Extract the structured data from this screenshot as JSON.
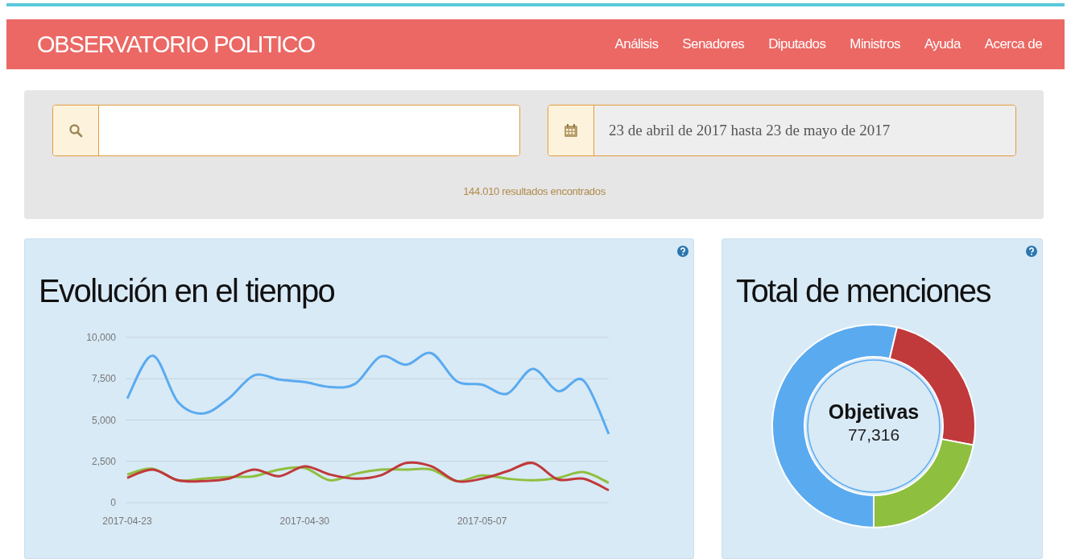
{
  "navbar": {
    "brand": "OBSERVATORIO POLITICO",
    "links": [
      "Análisis",
      "Senadores",
      "Diputados",
      "Ministros",
      "Ayuda",
      "Acerca de"
    ]
  },
  "search": {
    "date_field": {
      "value": "23 de abril de 2017 hasta 23 de mayo de 2017"
    },
    "results": "144.010 resultados encontrados"
  },
  "evolution_card": {
    "title": "Evolución en el tiempo",
    "chart_data": {
      "type": "line",
      "grid": true,
      "categories": [
        "2017-04-23",
        null,
        null,
        null,
        null,
        null,
        null,
        "2017-04-30",
        null,
        null,
        null,
        null,
        null,
        null,
        "2017-05-07",
        null,
        null,
        null,
        null,
        null
      ],
      "series": [
        {
          "color": "#5aaaf0",
          "values": [
            6300,
            8900,
            6100,
            5400,
            6300,
            7700,
            7450,
            7300,
            7000,
            7200,
            8850,
            8350,
            9050,
            7350,
            7150,
            6600,
            8100,
            6750,
            7400,
            4150
          ]
        },
        {
          "color": "#8fbf3f",
          "values": [
            1700,
            2050,
            1350,
            1450,
            1550,
            1600,
            2000,
            2100,
            1350,
            1750,
            2000,
            2000,
            2000,
            1300,
            1650,
            1450,
            1350,
            1500,
            1850,
            1200
          ]
        },
        {
          "color": "#c0393b",
          "values": [
            1500,
            2000,
            1350,
            1300,
            1450,
            2000,
            1600,
            2200,
            1700,
            1450,
            1650,
            2400,
            2200,
            1300,
            1450,
            1900,
            2400,
            1400,
            1450,
            750
          ]
        }
      ],
      "ylim": [
        0,
        10000
      ],
      "yticks": [
        {
          "value": 0,
          "label": "0"
        },
        {
          "value": 2500,
          "label": "2,500"
        },
        {
          "value": 5000,
          "label": "5,000"
        },
        {
          "value": 7500,
          "label": "7,500"
        },
        {
          "value": 10000,
          "label": "10,000"
        }
      ]
    }
  },
  "mentions_card": {
    "title": "Total de menciones",
    "center_label": "Objetivas",
    "center_value": "77,316",
    "chart_data": {
      "type": "donut",
      "values": [
        53.7,
        24.3,
        22.0
      ],
      "colors": [
        "#5aaaf0",
        "#c0393b",
        "#8fbf3f"
      ]
    }
  }
}
